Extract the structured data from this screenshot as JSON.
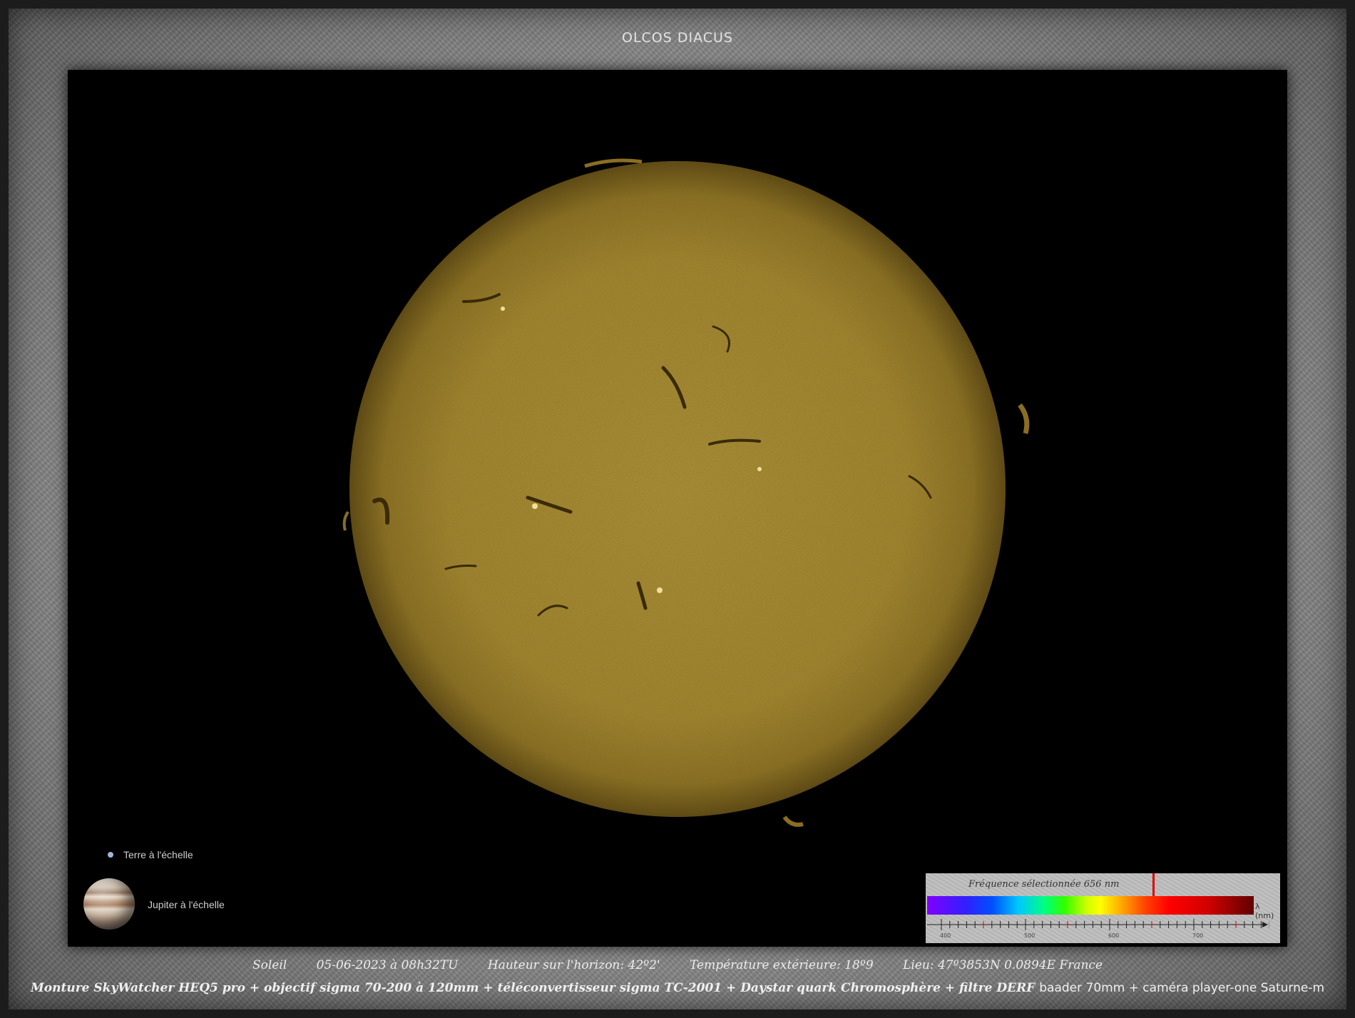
{
  "title": "OLCOS DIACUS",
  "scale": {
    "earth_label": "Terre à l'échelle",
    "jupiter_label": "Jupiter à l'échelle"
  },
  "spectrum": {
    "frequency_label": "Fréquence sélectionnée 656 nm",
    "axis_unit": "λ (nm)",
    "ticks": [
      "400",
      "500",
      "600",
      "700"
    ],
    "selected_nm": 656
  },
  "footer": {
    "object": "Soleil",
    "date": "05-06-2023  à  08h32TU",
    "altitude": "Hauteur sur l'horizon: 42º2'",
    "temperature": "Température extérieure: 18º9",
    "location": "Lieu: 47º3853N     0.0894E      France",
    "equipment": "Monture SkyWatcher HEQ5 pro +  objectif sigma  70-200 à 120mm  +  téléconvertisseur sigma TC-2001 +  Daystar quark Chromosphère  +  filtre DERF",
    "equipment_tail": "baader 70mm +  caméra player-one Saturne-m"
  },
  "colors": {
    "sun_core": "#b89a3a",
    "sun_limb": "#5a4410",
    "marker": "#e00000"
  },
  "icons": [
    "earth-icon",
    "jupiter-icon",
    "spectrum-marker-icon"
  ]
}
